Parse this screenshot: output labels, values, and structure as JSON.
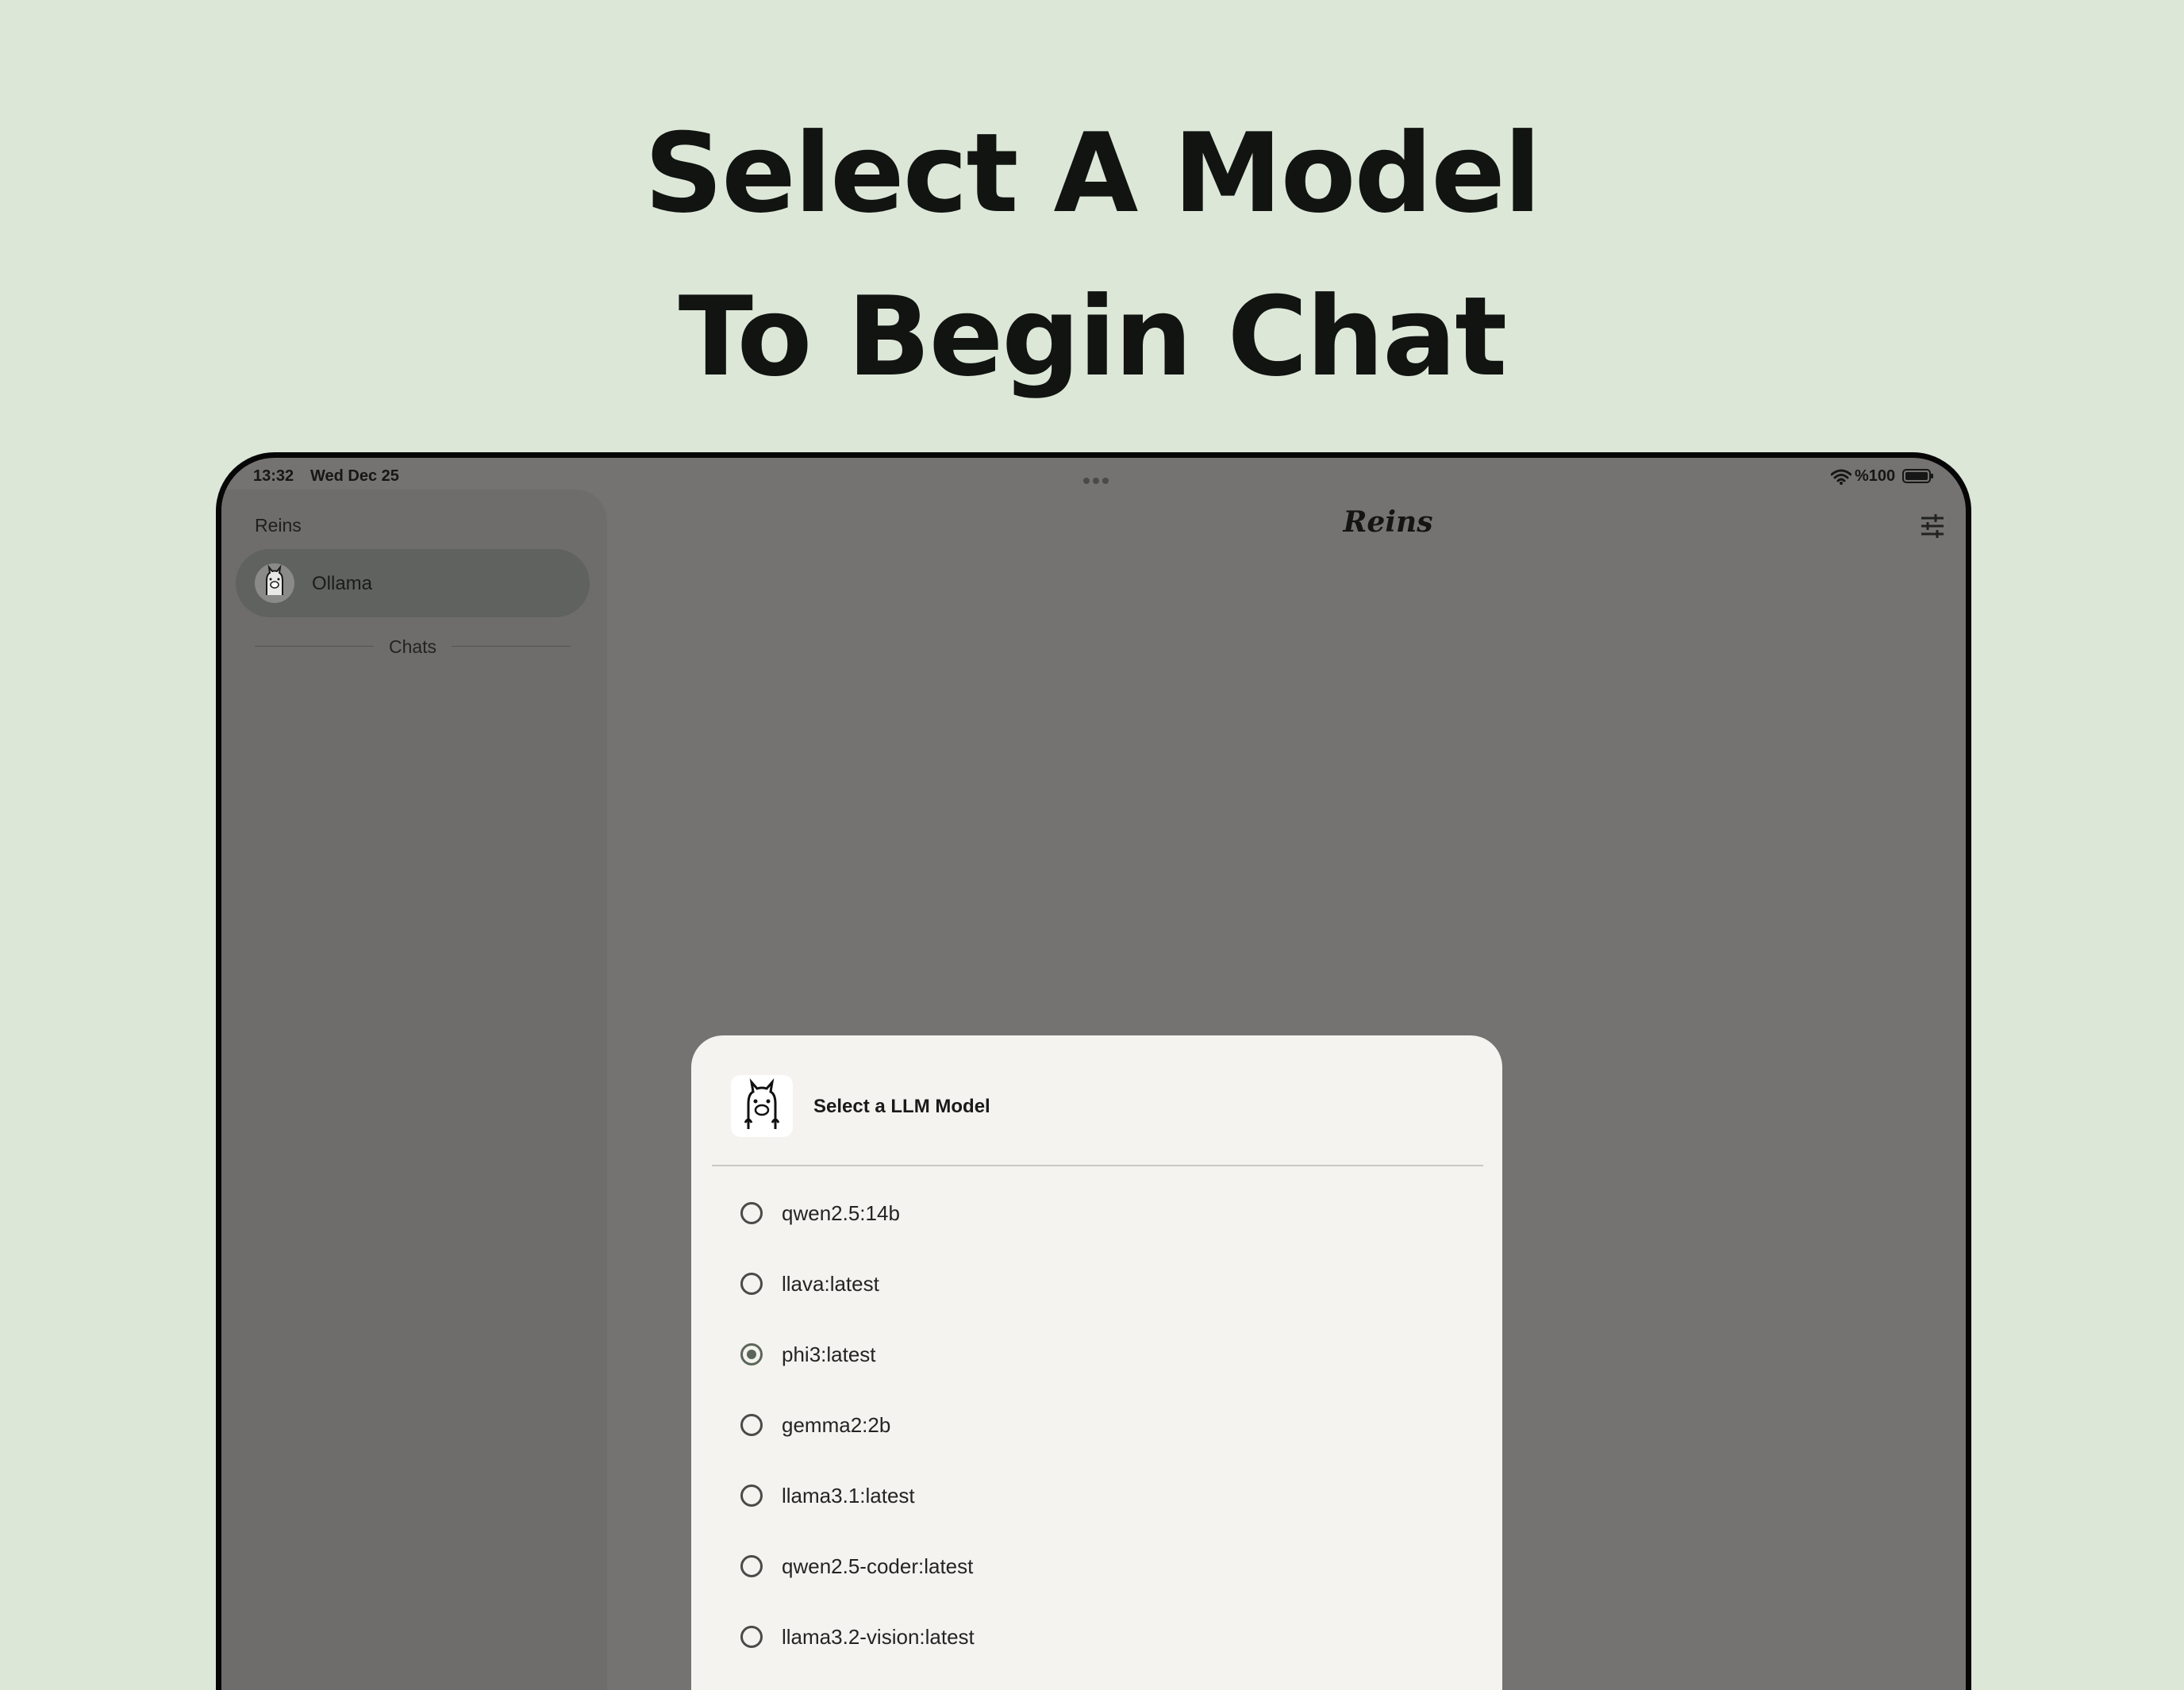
{
  "headline": {
    "line1": "Select A Model",
    "line2": "To Begin Chat"
  },
  "status_bar": {
    "time": "13:32",
    "date": "Wed Dec 25",
    "battery": "%100"
  },
  "sidebar": {
    "title": "Reins",
    "items": [
      {
        "label": "Ollama",
        "icon": "llama-icon"
      }
    ],
    "section_label": "Chats"
  },
  "app_bar": {
    "title": "Reins",
    "settings_icon": "tune-icon"
  },
  "dialog": {
    "title": "Select a LLM Model",
    "icon": "llama-icon",
    "models": [
      {
        "label": "qwen2.5:14b",
        "selected": false
      },
      {
        "label": "llava:latest",
        "selected": false
      },
      {
        "label": "phi3:latest",
        "selected": true
      },
      {
        "label": "gemma2:2b",
        "selected": false
      },
      {
        "label": "llama3.1:latest",
        "selected": false
      },
      {
        "label": "qwen2.5-coder:latest",
        "selected": false
      },
      {
        "label": "llama3.2-vision:latest",
        "selected": false
      }
    ]
  },
  "colors": {
    "page_background": "#dce7d8",
    "scrim": "#747371",
    "dialog_background": "#f4f3ef",
    "accent": "#5b6658"
  }
}
